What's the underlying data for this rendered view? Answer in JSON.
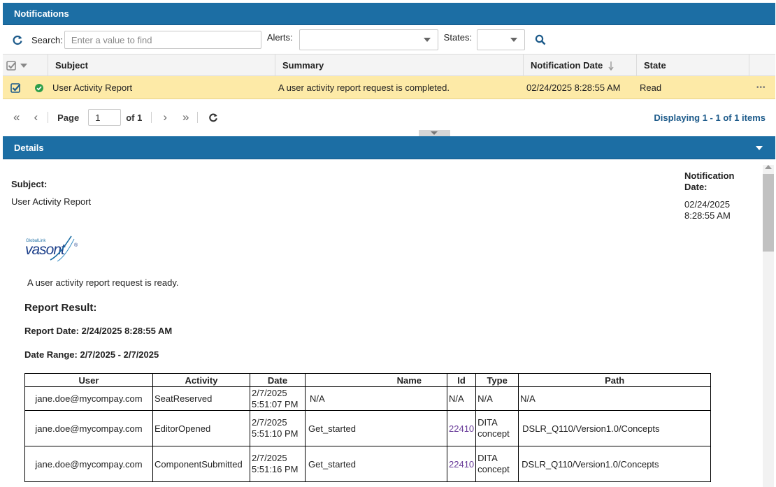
{
  "panel": {
    "title": "Notifications"
  },
  "toolbar": {
    "search_label": "Search:",
    "search_placeholder": "Enter a value to find",
    "alerts_label": "Alerts:",
    "states_label": "States:"
  },
  "grid": {
    "columns": [
      "Subject",
      "Summary",
      "Notification Date",
      "State"
    ],
    "rows": [
      {
        "subject": "User Activity Report",
        "summary": "A user activity report request is completed.",
        "date": "02/24/2025 8:28:55 AM",
        "state": "Read",
        "more": "•••"
      }
    ]
  },
  "pager": {
    "page_label": "Page",
    "page_value": "1",
    "of_label": "of 1",
    "display_text": "Displaying 1 - 1 of 1 items"
  },
  "details": {
    "title": "Details",
    "subject_label": "Subject:",
    "subject_value": "User Activity Report",
    "date_label": "Notification Date:",
    "date_value": "02/24/2025 8:28:55 AM",
    "logo_small": "GlobalLink",
    "logo_text": "vasont",
    "message": "A user activity report request is ready.",
    "report_title": "Report Result:",
    "report_date": "Report Date: 2/24/2025 8:28:55 AM",
    "date_range": "Date Range: 2/7/2025 - 2/7/2025"
  },
  "report": {
    "headers": [
      "User",
      "Activity",
      "Date",
      "Name",
      "Id",
      "Type",
      "Path"
    ],
    "rows": [
      {
        "user": "jane.doe@mycompay.com",
        "activity": "SeatReserved",
        "date1": "2/7/2025",
        "date2": "5:51:07 PM",
        "name": "N/A",
        "id": "N/A",
        "type1": "N/A",
        "type2": "",
        "path": "N/A"
      },
      {
        "user": "jane.doe@mycompay.com",
        "activity": "EditorOpened",
        "date1": "2/7/2025",
        "date2": "5:51:10 PM",
        "name": "Get_started",
        "id": "22410",
        "type1": "DITA",
        "type2": "concept",
        "path": "DSLR_Q110/Version1.0/Concepts"
      },
      {
        "user": "jane.doe@mycompay.com",
        "activity": "ComponentSubmitted",
        "date1": "2/7/2025",
        "date2": "5:51:16 PM",
        "name": "Get_started",
        "id": "22410",
        "type1": "DITA",
        "type2": "concept",
        "path": "DSLR_Q110/Version1.0/Concepts"
      }
    ]
  },
  "colors": {
    "header_bar": "#1c6ea4",
    "selected_row": "#fdeaa7",
    "status_ok": "#2e9e4a",
    "link": "#6a3d9a"
  }
}
